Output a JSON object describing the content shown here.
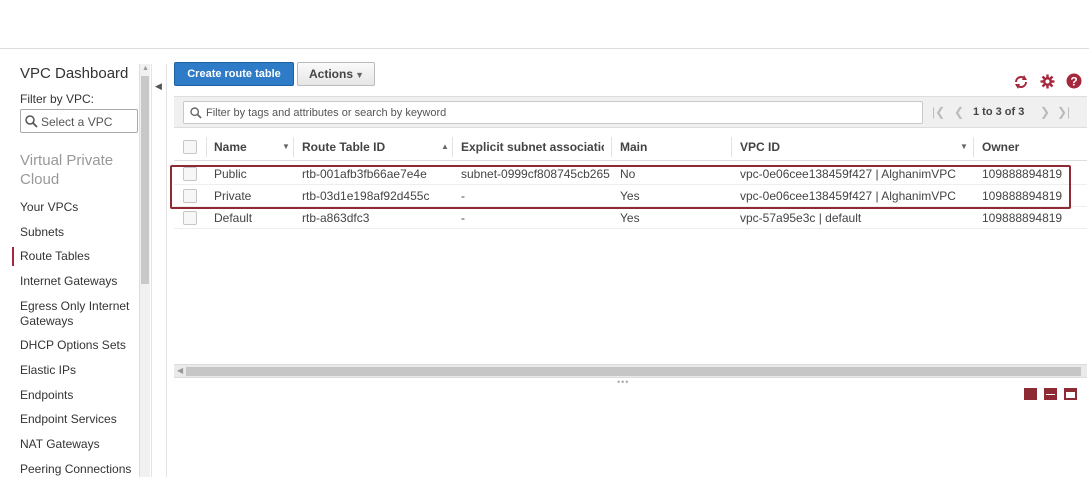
{
  "sidebar": {
    "title": "VPC Dashboard",
    "filter_label": "Filter by VPC:",
    "select_placeholder": "Select a VPC",
    "section_title": "Virtual Private Cloud",
    "items": [
      {
        "label": "Your VPCs"
      },
      {
        "label": "Subnets"
      },
      {
        "label": "Route Tables",
        "active": true
      },
      {
        "label": "Internet Gateways"
      },
      {
        "label": "Egress Only Internet Gateways"
      },
      {
        "label": "DHCP Options Sets"
      },
      {
        "label": "Elastic IPs"
      },
      {
        "label": "Endpoints"
      },
      {
        "label": "Endpoint Services"
      },
      {
        "label": "NAT Gateways"
      },
      {
        "label": "Peering Connections"
      }
    ]
  },
  "toolbar": {
    "create_label": "Create route table",
    "actions_label": "Actions"
  },
  "search": {
    "placeholder": "Filter by tags and attributes or search by keyword"
  },
  "pager": {
    "count": "1 to 3 of 3"
  },
  "table": {
    "columns": [
      "Name",
      "Route Table ID",
      "Explicit subnet association",
      "Main",
      "VPC ID",
      "Owner"
    ],
    "rows": [
      {
        "name": "Public",
        "id": "rtb-001afb3fb66ae7e4e",
        "subnet": "subnet-0999cf808745cb265",
        "main": "No",
        "vpc": "vpc-0e06cee138459f427 | AlghanimVPC",
        "owner": "109888894819"
      },
      {
        "name": "Private",
        "id": "rtb-03d1e198af92d455c",
        "subnet": "-",
        "main": "Yes",
        "vpc": "vpc-0e06cee138459f427 | AlghanimVPC",
        "owner": "109888894819"
      },
      {
        "name": "Default",
        "id": "rtb-a863dfc3",
        "subnet": "-",
        "main": "Yes",
        "vpc": "vpc-57a95e3c | default",
        "owner": "109888894819"
      }
    ]
  },
  "colors": {
    "accent": "#a5283c",
    "primary_button": "#2e7bc8",
    "highlight_border": "#8e2a33"
  },
  "icons": {
    "refresh": "refresh-icon",
    "settings": "gear-icon",
    "help": "help-icon"
  }
}
